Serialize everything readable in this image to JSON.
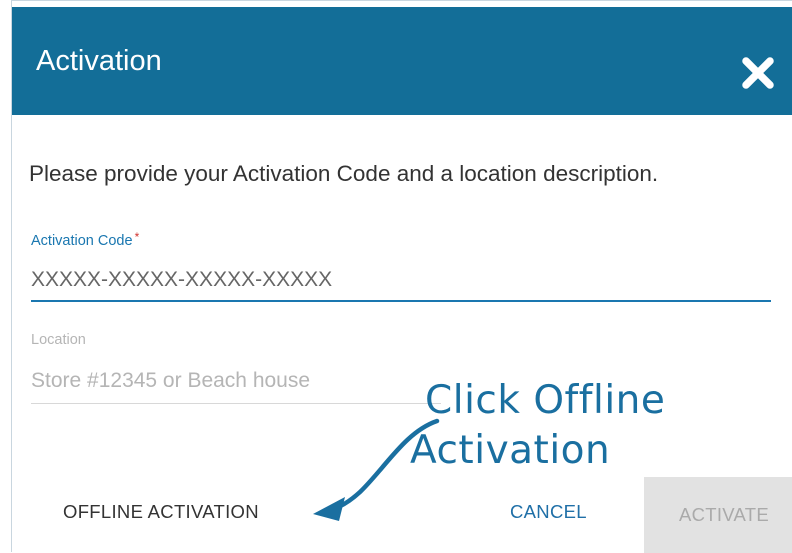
{
  "dialog": {
    "title": "Activation",
    "instructions": "Please provide your Activation Code and a location description."
  },
  "fields": {
    "activation_code": {
      "label": "Activation Code",
      "required_mark": "*",
      "value": "XXXXX-XXXXX-XXXXX-XXXXX"
    },
    "location": {
      "label": "Location",
      "placeholder": "Store #12345 or Beach house"
    }
  },
  "buttons": {
    "offline": "OFFLINE ACTIVATION",
    "cancel": "CANCEL",
    "activate": "ACTIVATE"
  },
  "annotation": {
    "line1": "Click Offline",
    "line2": "Activation"
  },
  "colors": {
    "header": "#136e98",
    "accent": "#1a77b0",
    "annotation": "#1a6fa0",
    "disabled_button": "#e2e2e2"
  },
  "icons": {
    "close": "close-icon",
    "arrow": "arrow-icon"
  }
}
